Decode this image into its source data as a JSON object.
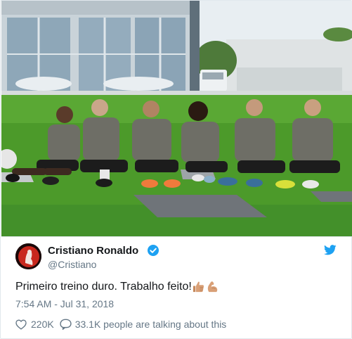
{
  "tweet": {
    "author_name": "Cristiano Ronaldo",
    "handle": "@Cristiano",
    "text": "Primeiro treino duro. Trabalho feito!",
    "emojis": [
      "thumbs-up-medium-skin-icon",
      "flexed-biceps-medium-skin-icon"
    ],
    "timestamp": "7:54 AM - Jul 31, 2018",
    "like_count": "220K",
    "conversation_text": "33.1K people are talking about this"
  },
  "icons": {
    "verified": "verified-badge-icon",
    "brand": "twitter-bird-icon",
    "like": "heart-icon",
    "reply": "speech-bubble-icon"
  },
  "colors": {
    "brand_blue": "#1da1f2",
    "text_primary": "#14171a",
    "text_secondary": "#657786",
    "grass": "#4c9a2a",
    "jersey": "#6e6e66"
  }
}
